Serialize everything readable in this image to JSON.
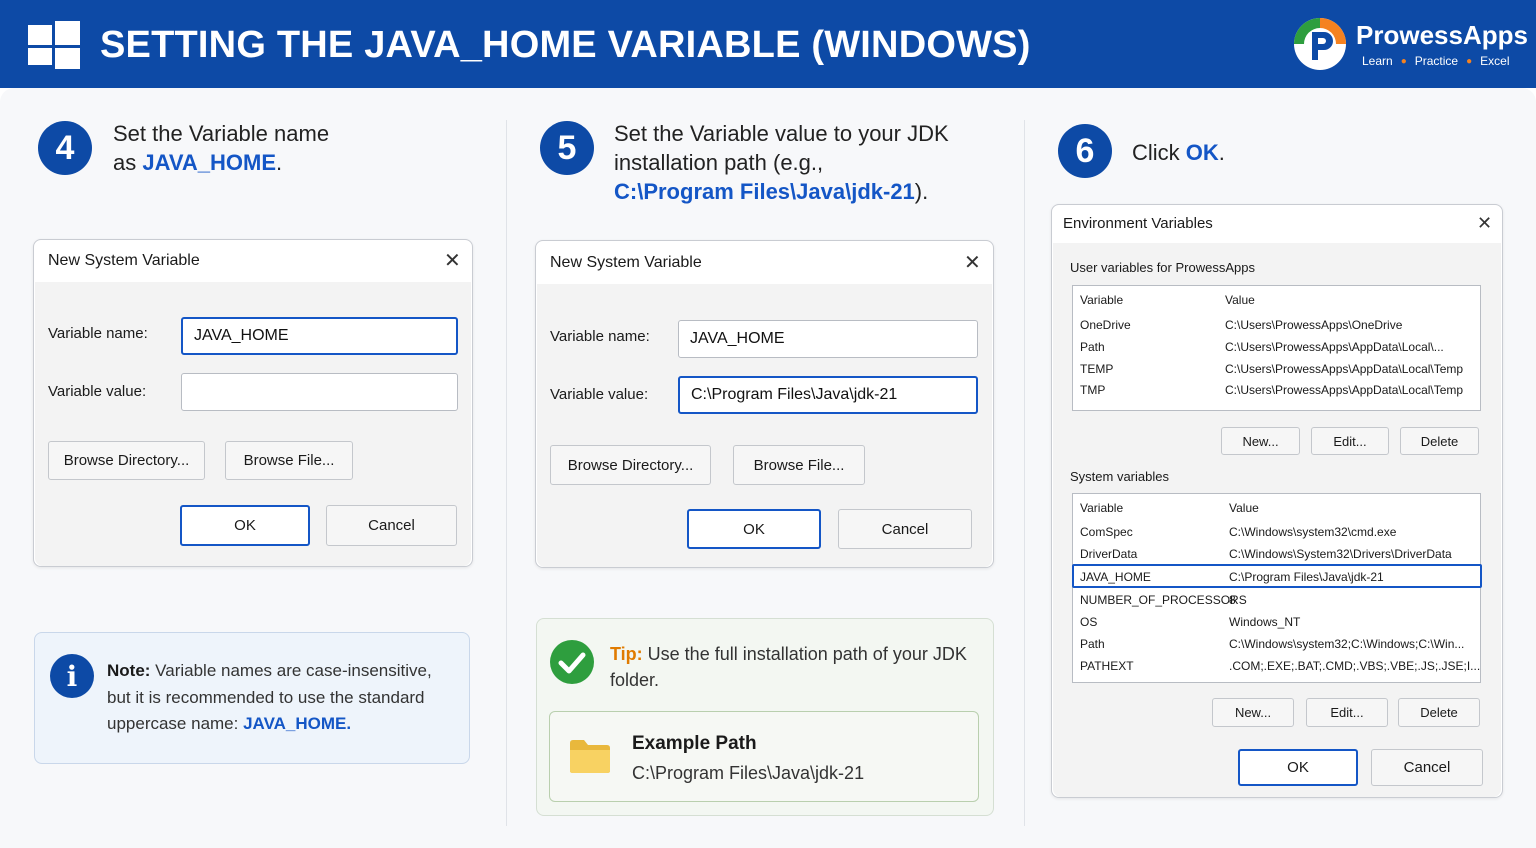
{
  "header": {
    "title": "SETTING THE JAVA_HOME VARIABLE (WINDOWS)",
    "brand_name": "ProwessApps",
    "brand_tagline": [
      "Learn",
      "Practice",
      "Excel"
    ],
    "colors": {
      "banner": "#0d4aa6",
      "accent": "#1456c6",
      "orange": "#f58220",
      "green": "#2e9e3e"
    }
  },
  "step4": {
    "number": "4",
    "line1": "Set the Variable name",
    "line2_prefix": "as ",
    "line2_highlight": "JAVA_HOME",
    "line2_suffix": ".",
    "dialog": {
      "title": "New System Variable",
      "name_label": "Variable name:",
      "name_value": "JAVA_HOME",
      "value_label": "Variable value:",
      "value_value": "",
      "browse_dir": "Browse Directory...",
      "browse_file": "Browse File...",
      "ok": "OK",
      "cancel": "Cancel"
    },
    "note": {
      "label": "Note:",
      "text": " Variable names are case-insensitive, but it is recommended to use the standard uppercase name: ",
      "highlight": "JAVA_HOME."
    }
  },
  "step5": {
    "number": "5",
    "line1": "Set the Variable value to your JDK",
    "line2": "installation path (e.g.,",
    "line3_highlight": "C:\\Program Files\\Java\\jdk-21",
    "line3_suffix": ").",
    "dialog": {
      "title": "New System Variable",
      "name_label": "Variable name:",
      "name_value": "JAVA_HOME",
      "value_label": "Variable value:",
      "value_value": "C:\\Program Files\\Java\\jdk-21",
      "browse_dir": "Browse Directory...",
      "browse_file": "Browse File...",
      "ok": "OK",
      "cancel": "Cancel"
    },
    "tip": {
      "label": "Tip:",
      "text": " Use the full installation path of your JDK folder.",
      "example_title": "Example Path",
      "example_path": "C:\\Program Files\\Java\\jdk-21"
    }
  },
  "step6": {
    "number": "6",
    "prefix": "Click ",
    "highlight": "OK",
    "suffix": ".",
    "dialog": {
      "title": "Environment Variables",
      "user_group": "User variables for ProwessApps",
      "col_variable": "Variable",
      "col_value": "Value",
      "user_rows": [
        {
          "name": "OneDrive",
          "value": "C:\\Users\\ProwessApps\\OneDrive"
        },
        {
          "name": "Path",
          "value": "C:\\Users\\ProwessApps\\AppData\\Local\\..."
        },
        {
          "name": "TEMP",
          "value": "C:\\Users\\ProwessApps\\AppData\\Local\\Temp"
        },
        {
          "name": "TMP",
          "value": "C:\\Users\\ProwessApps\\AppData\\Local\\Temp"
        }
      ],
      "user_buttons": {
        "new": "New...",
        "edit": "Edit...",
        "delete": "Delete"
      },
      "system_group": "System variables",
      "system_rows": [
        {
          "name": "ComSpec",
          "value": "C:\\Windows\\system32\\cmd.exe"
        },
        {
          "name": "DriverData",
          "value": "C:\\Windows\\System32\\Drivers\\DriverData"
        },
        {
          "name": "JAVA_HOME",
          "value": "C:\\Program Files\\Java\\jdk-21"
        },
        {
          "name": "NUMBER_OF_PROCESSORS",
          "value": "8"
        },
        {
          "name": "OS",
          "value": "Windows_NT"
        },
        {
          "name": "Path",
          "value": "C:\\Windows\\system32;C:\\Windows;C:\\Win..."
        },
        {
          "name": "PATHEXT",
          "value": ".COM;.EXE;.BAT;.CMD;.VBS;.VBE;.JS;.JSE;I..."
        }
      ],
      "system_buttons": {
        "new": "New...",
        "edit": "Edit...",
        "delete": "Delete"
      },
      "ok": "OK",
      "cancel": "Cancel"
    }
  }
}
